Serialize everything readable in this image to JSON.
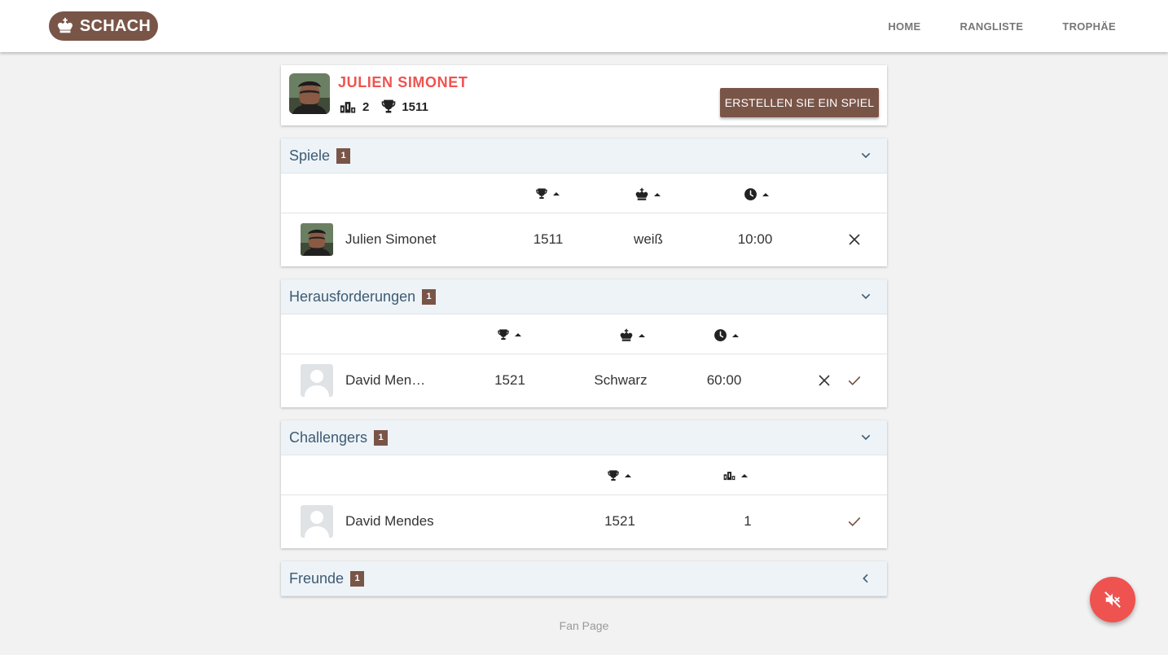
{
  "brand": {
    "name": "SCHACH",
    "icon": "chess-king-icon",
    "color": "#795548"
  },
  "nav": {
    "items": [
      "HOME",
      "RANGLISTE",
      "TROPHÄE"
    ]
  },
  "profile": {
    "name": "JULIEN SIMONET",
    "rank": "2",
    "trophies": "1511",
    "create_button": "ERSTELLEN SIE EIN SPIEL"
  },
  "games": {
    "title": "Spiele",
    "count": "1",
    "columns": [
      "trophy-icon",
      "chess-king-icon",
      "clock-icon"
    ],
    "rows": [
      {
        "name": "Julien Simonet",
        "elo": "1511",
        "color": "weiß",
        "time": "10:00"
      }
    ]
  },
  "challenges": {
    "title": "Herausforderungen",
    "count": "1",
    "columns": [
      "trophy-icon",
      "chess-king-icon",
      "clock-icon"
    ],
    "rows": [
      {
        "name": "David Men…",
        "elo": "1521",
        "color": "Schwarz",
        "time": "60:00"
      }
    ]
  },
  "challengers": {
    "title": "Challengers",
    "count": "1",
    "columns": [
      "trophy-icon",
      "podium-icon"
    ],
    "rows": [
      {
        "name": "David Mendes",
        "elo": "1521",
        "rank": "1"
      }
    ]
  },
  "friends": {
    "title": "Freunde",
    "count": "1"
  },
  "footer": {
    "fan_page": "Fan Page"
  },
  "colors": {
    "accent": "#795548",
    "name_red": "#ef5350",
    "panel_head": "#edf3f7",
    "panel_title": "#3e5b73"
  }
}
